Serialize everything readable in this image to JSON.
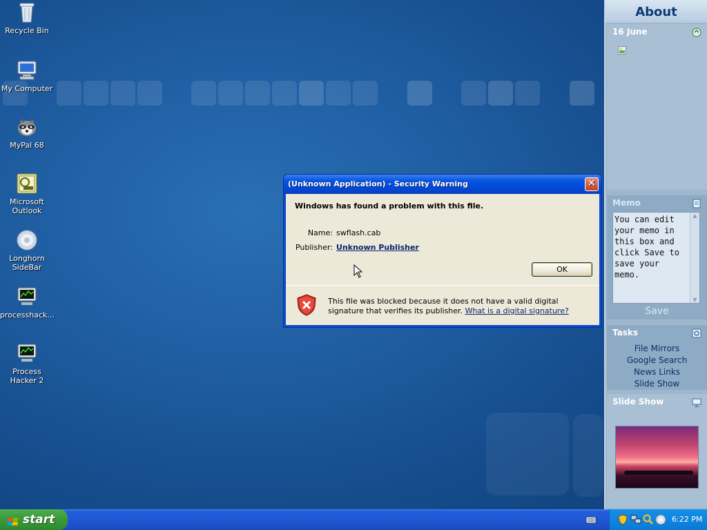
{
  "desktop": {
    "icons": [
      {
        "label": "Recycle Bin",
        "icon": "recycle-bin-icon"
      },
      {
        "label": "My Computer",
        "icon": "computer-icon"
      },
      {
        "label": "MyPal 68",
        "icon": "raccoon-browser-icon"
      },
      {
        "label": "Microsoft Outlook",
        "icon": "outlook-icon"
      },
      {
        "label": "Longhorn SideBar",
        "icon": "sidebar-orb-icon"
      },
      {
        "label": "processhack...",
        "icon": "process-hacker-icon"
      },
      {
        "label": "Process Hacker 2",
        "icon": "process-hacker-icon"
      }
    ]
  },
  "sidebar": {
    "title": "About",
    "calendar": {
      "date": "16 June"
    },
    "memo": {
      "heading": "Memo",
      "text": "You can edit your memo in this box and click Save to save your memo.",
      "save_label": "Save"
    },
    "tasks": {
      "heading": "Tasks",
      "items": [
        "File Mirrors",
        "Google Search",
        "News Links",
        "Slide Show"
      ]
    },
    "slideshow": {
      "heading": "Slide Show"
    }
  },
  "dialog": {
    "title": "(Unknown Application) - Security Warning",
    "heading": "Windows has found a problem with this file.",
    "name_label": "Name:",
    "name_value": "swflash.cab",
    "publisher_label": "Publisher:",
    "publisher_value": "Unknown Publisher",
    "ok_label": "OK",
    "warning_text": "This file was blocked because it does not have a valid digital signature that verifies its publisher.",
    "warning_link": "What is a digital signature?"
  },
  "taskbar": {
    "start_label": "start",
    "clock": "6:22 PM"
  },
  "colors": {
    "desktop": "#1f5da1",
    "titlebar": "#0a56e0",
    "dialog_body": "#ece9d8",
    "sidebar": "#9fb7cd"
  }
}
